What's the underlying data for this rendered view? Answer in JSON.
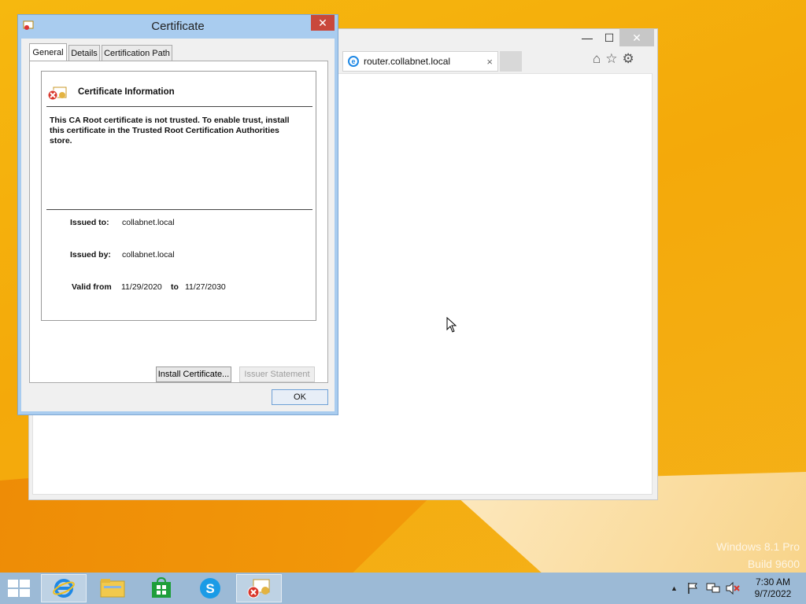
{
  "browser": {
    "tab_title": "router.collabnet.local",
    "tab_close": "×",
    "btn_min": "—",
    "btn_max": "☐",
    "btn_close": "✕",
    "tools": [
      "⌂",
      "☆",
      "⚙"
    ]
  },
  "certificate": {
    "title": "Certificate",
    "close": "✕",
    "tabs": [
      "General",
      "Details",
      "Certification Path"
    ],
    "info_heading": "Certificate Information",
    "warning": "This CA Root certificate is not trusted. To enable trust, install this certificate in the Trusted Root Certification Authorities store.",
    "issued_to_label": "Issued to:",
    "issued_to": "collabnet.local",
    "issued_by_label": "Issued by:",
    "issued_by": "collabnet.local",
    "valid_from_label": "Valid from",
    "valid_from": "11/29/2020",
    "to_label": "to",
    "valid_to": "11/27/2030",
    "install_button": "Install Certificate...",
    "issuer_statement_button": "Issuer Statement",
    "ok_button": "OK"
  },
  "watermark": {
    "line1": "Windows 8.1 Pro",
    "line2": "Build 9600"
  },
  "taskbar": {
    "time": "7:30 AM",
    "date": "9/7/2022",
    "tray_up": "▲"
  },
  "colors": {
    "taskbar": "#9cbad6",
    "dialog_frame": "#a9ccef",
    "close_red": "#c9483b"
  }
}
